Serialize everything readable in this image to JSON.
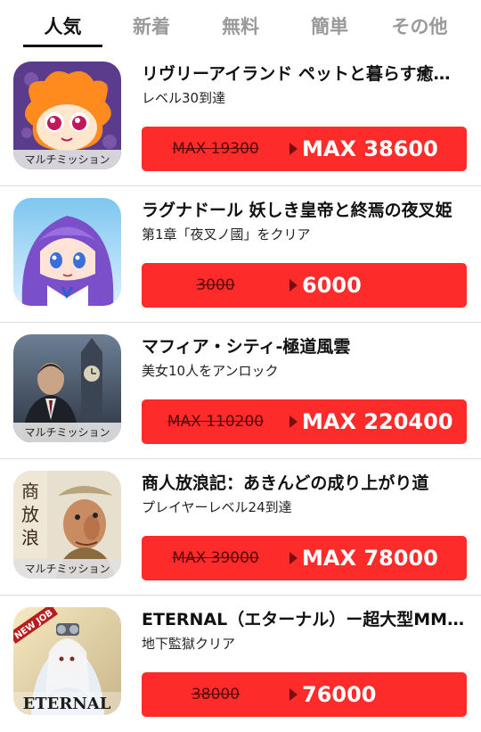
{
  "tabs": [
    {
      "label": "人気",
      "active": true
    },
    {
      "label": "新着",
      "active": false
    },
    {
      "label": "無料",
      "active": false
    },
    {
      "label": "簡単",
      "active": false
    },
    {
      "label": "その他",
      "active": false
    }
  ],
  "items": [
    {
      "title": "リヴリーアイランド ペットと暮らす癒やしのお庭",
      "subtitle": "レベル30到達",
      "badge": "マルチミッション",
      "old_value": "MAX 19300",
      "new_value": "MAX 38600",
      "icon": "livly-island-game-icon"
    },
    {
      "title": "ラグナドール 妖しき皇帝と終焉の夜叉姫",
      "subtitle": "第1章「夜叉ノ國」をクリア",
      "badge": "",
      "old_value": "3000",
      "new_value": "6000",
      "icon": "ragnador-game-icon"
    },
    {
      "title": "マフィア・シティ-極道風雲",
      "subtitle": "美女10人をアンロック",
      "badge": "マルチミッション",
      "old_value": "MAX 110200",
      "new_value": "MAX 220400",
      "icon": "mafia-city-game-icon"
    },
    {
      "title": "商人放浪記：あきんどの成り上がり道",
      "subtitle": "プレイヤーレベル24到達",
      "badge": "マルチミッション",
      "old_value": "MAX 39000",
      "new_value": "MAX 78000",
      "icon": "akindo-game-icon"
    },
    {
      "title": "ETERNAL（エターナル）ー超大型MMORPG",
      "subtitle": "地下監獄クリア",
      "badge": "",
      "old_value": "38000",
      "new_value": "76000",
      "icon": "eternal-game-icon",
      "icon_text": {
        "tag": "NEW JOB",
        "logo": "ETERNAL"
      }
    }
  ],
  "colors": {
    "button": "#fe2b2b",
    "tab_active": "#111111",
    "tab_inactive": "#9a9a9a"
  }
}
